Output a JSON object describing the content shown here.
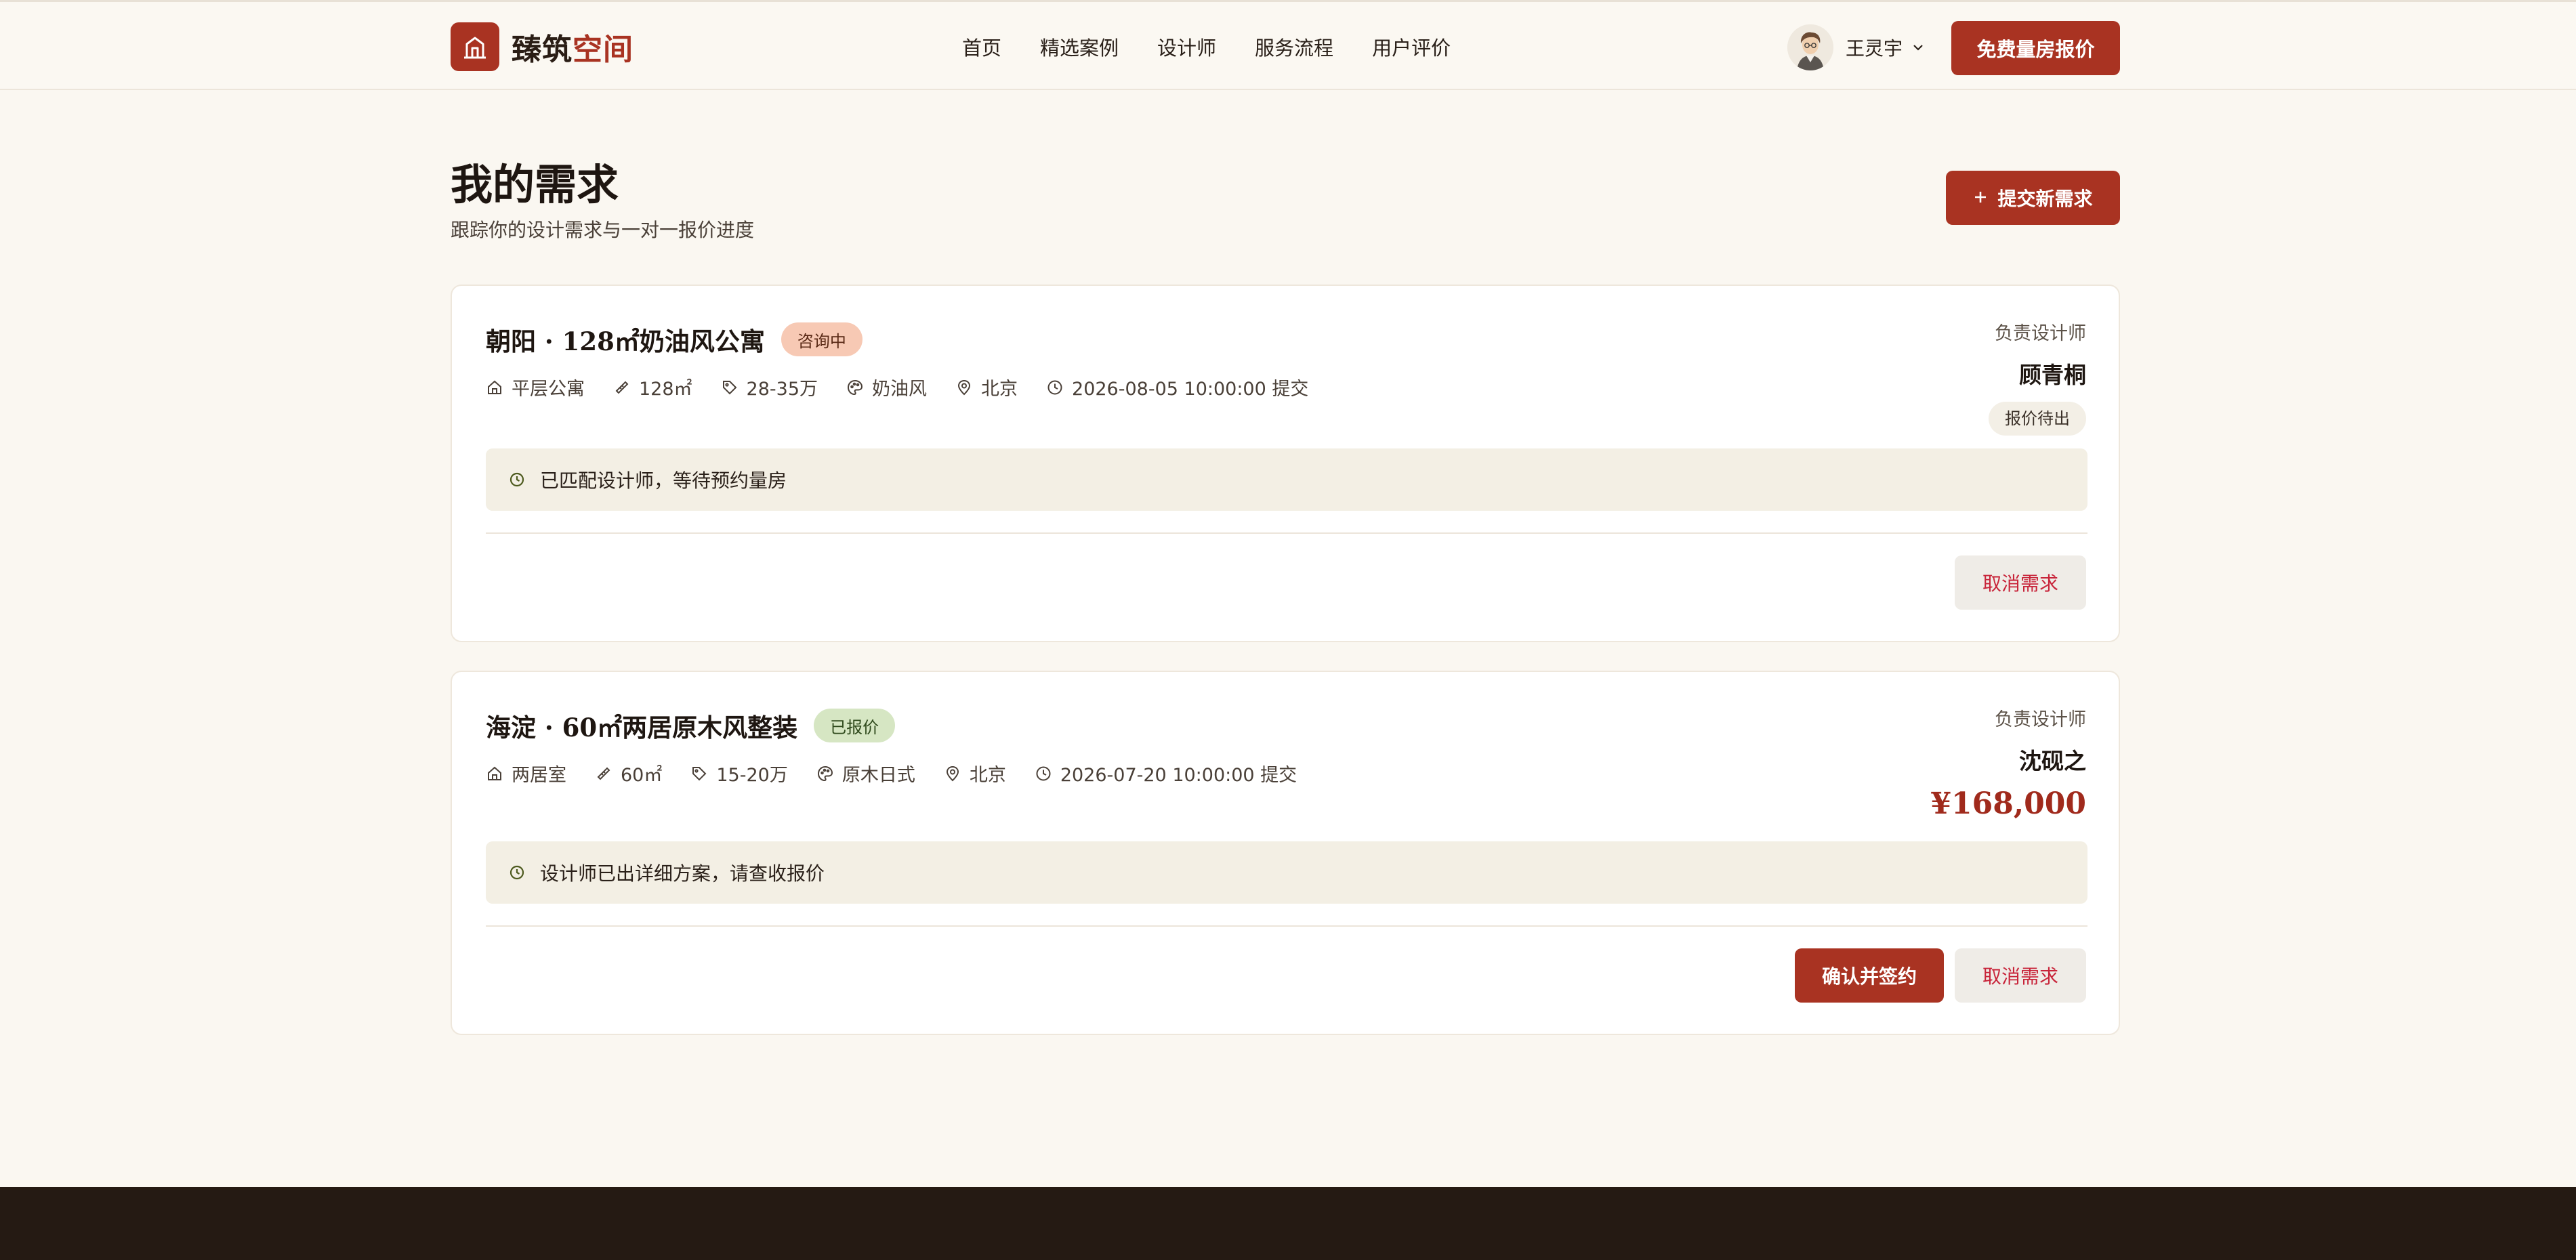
{
  "header": {
    "brand_main": "臻筑",
    "brand_accent": "空间",
    "nav": [
      "首页",
      "精选案例",
      "设计师",
      "服务流程",
      "用户评价"
    ],
    "user_name": "王灵宇",
    "cta_label": "免费量房报价"
  },
  "page": {
    "title": "我的需求",
    "subtitle": "跟踪你的设计需求与一对一报价进度",
    "new_request_label": "提交新需求",
    "new_request_icon": "plus-icon"
  },
  "requests": [
    {
      "title": "朝阳 · 128㎡奶油风公寓",
      "status": "咨询中",
      "house_type": "平层公寓",
      "area": "128㎡",
      "budget": "28-35万",
      "style": "奶油风",
      "city": "北京",
      "submitted": "2026-08-05 10:00:00 提交",
      "designer_label": "负责设计师",
      "designer": "顾青桐",
      "quote_status": "报价待出",
      "notice": "已匹配设计师，等待预约量房",
      "cancel_label": "取消需求"
    },
    {
      "title": "海淀 · 60㎡两居原木风整装",
      "status": "已报价",
      "house_type": "两居室",
      "area": "60㎡",
      "budget": "15-20万",
      "style": "原木日式",
      "city": "北京",
      "submitted": "2026-07-20 10:00:00 提交",
      "designer_label": "负责设计师",
      "designer": "沈砚之",
      "price": "¥168,000",
      "notice": "设计师已出详细方案，请查收报价",
      "confirm_label": "确认并签约",
      "cancel_label": "取消需求"
    }
  ],
  "colors": {
    "brand": "#a93322",
    "background": "#faf7f1",
    "footer": "#251a13"
  }
}
